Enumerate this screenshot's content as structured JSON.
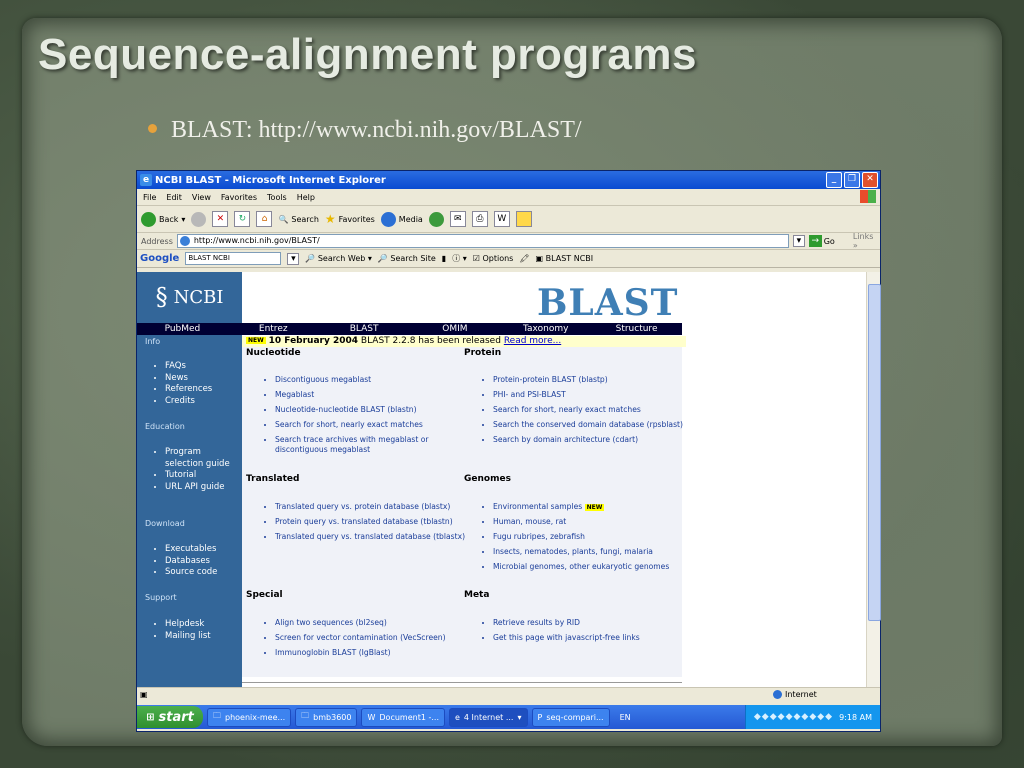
{
  "slide": {
    "title": "Sequence-alignment programs",
    "bullet": "BLAST: http://www.ncbi.nih.gov/BLAST/"
  },
  "browser": {
    "window_title": "NCBI BLAST - Microsoft Internet Explorer",
    "menu": [
      "File",
      "Edit",
      "View",
      "Favorites",
      "Tools",
      "Help"
    ],
    "toolbar": {
      "back": "Back",
      "search": "Search",
      "favorites": "Favorites",
      "media": "Media"
    },
    "address_label": "Address",
    "address_value": "http://www.ncbi.nih.gov/BLAST/",
    "go_label": "Go",
    "links_label": "Links",
    "google": {
      "logo": "Google",
      "query": "BLAST NCBI",
      "search_web": "Search Web",
      "search_site": "Search Site",
      "options": "Options"
    },
    "status_zone": "Internet"
  },
  "ncbi": {
    "logo_text": "NCBI",
    "blast_logo": "BLAST",
    "nav": [
      "PubMed",
      "Entrez",
      "BLAST",
      "OMIM",
      "Taxonomy",
      "Structure"
    ],
    "sidebar": {
      "info": {
        "title": "Info",
        "items": [
          "FAQs",
          "News",
          "References",
          "Credits"
        ]
      },
      "education": {
        "title": "Education",
        "items": [
          "Program selection guide",
          "Tutorial",
          "URL API guide"
        ]
      },
      "download": {
        "title": "Download",
        "items": [
          "Executables",
          "Databases",
          "Source code"
        ]
      },
      "support": {
        "title": "Support",
        "items": [
          "Helpdesk",
          "Mailing list"
        ]
      }
    },
    "announcement": {
      "badge": "NEW",
      "date": "10 February 2004",
      "text": " BLAST 2.2.8 has been released",
      "link": "Read more..."
    },
    "nucleotide": {
      "title": "Nucleotide",
      "items": [
        "Discontiguous megablast",
        "Megablast",
        "Nucleotide-nucleotide BLAST (blastn)",
        "Search for short, nearly exact matches",
        "Search trace archives with megablast or discontiguous megablast"
      ]
    },
    "protein": {
      "title": "Protein",
      "items": [
        "Protein-protein BLAST (blastp)",
        "PHI- and PSI-BLAST",
        "Search for short, nearly exact matches",
        "Search the conserved domain database (rpsblast)",
        "Search by domain architecture (cdart)"
      ]
    },
    "translated": {
      "title": "Translated",
      "items": [
        "Translated query vs. protein database (blastx)",
        "Protein query vs. translated database (tblastn)",
        "Translated query vs. translated database (tblastx)"
      ]
    },
    "genomes": {
      "title": "Genomes",
      "items": [
        "Environmental samples",
        "Human, mouse, rat",
        "Fugu rubripes, zebrafish",
        "Insects, nematodes, plants, fungi, malaria",
        "Microbial genomes, other eukaryotic genomes"
      ],
      "new_badge": "NEW"
    },
    "special": {
      "title": "Special",
      "items": [
        "Align two sequences (bl2seq)",
        "Screen for vector contamination (VecScreen)",
        "Immunoglobin BLAST (IgBlast)"
      ]
    },
    "meta": {
      "title": "Meta",
      "items": [
        "Retrieve results by RID",
        "Get this page with javascript-free links"
      ]
    }
  },
  "taskbar": {
    "start": "start",
    "tasks": [
      "phoenix-mee...",
      "bmb3600",
      "Document1 -...",
      "4 Internet ...",
      "seq-compari..."
    ],
    "lang": "EN",
    "clock": "9:18 AM"
  },
  "colors": {
    "ncbi_blue": "#336699",
    "nav_dark": "#000033",
    "announce_bg": "#ffffcc",
    "link_blue": "#1a3d99",
    "bullet_dot": "#e6a23c"
  }
}
